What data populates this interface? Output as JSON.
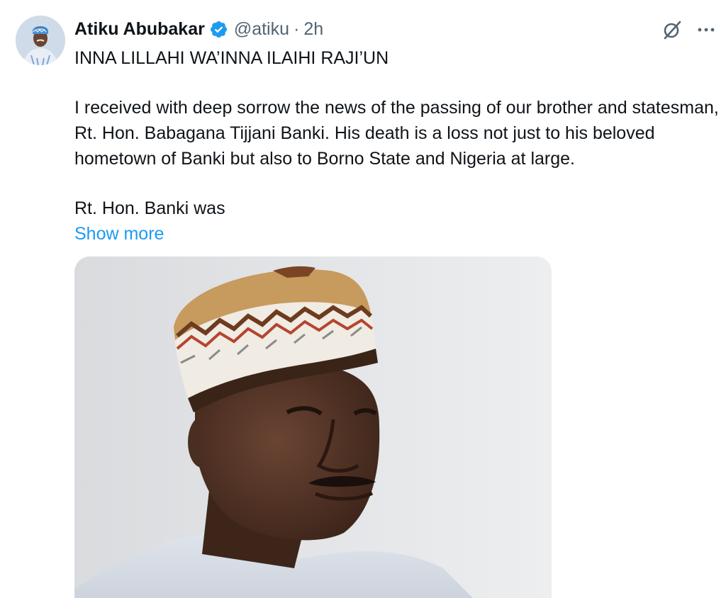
{
  "tweet": {
    "author_name": "Atiku Abubakar",
    "handle": "@atiku",
    "separator": "·",
    "time": "2h",
    "verified": true,
    "paragraphs": [
      "INNA LILLAHI WA’INNA ILAIHI RAJI’UN",
      "I received with deep sorrow the news of the passing of our brother and statesman, Rt. Hon. Babagana Tijjani Banki. His death is a loss not just to his beloved hometown of Banki but also to Borno State and Nigeria at large.",
      "Rt. Hon. Banki was"
    ],
    "show_more_label": "Show more"
  },
  "icons": {
    "verified": "verified-badge-icon",
    "grok": "grok-icon",
    "more": "more-options-icon"
  },
  "colors": {
    "link": "#1d9bf0",
    "secondary_text": "#536471",
    "verified_badge": "#1d9bf0"
  }
}
